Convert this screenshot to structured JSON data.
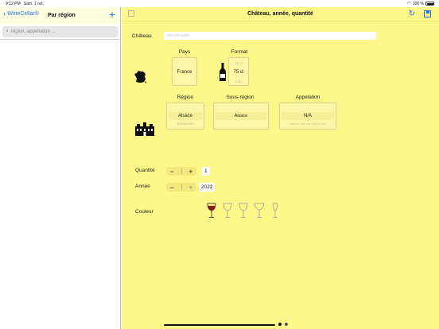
{
  "status_bar": {
    "time": "9:12 PM",
    "date": "Sam. 1 oct.",
    "battery": "100 %"
  },
  "sidebar": {
    "back_label": "WineCellar®",
    "title": "Par région",
    "add_icon": "plus-icon",
    "search": {
      "placeholder": "région, appellation ..."
    }
  },
  "main": {
    "title": "Château, année, quantité",
    "chateau": {
      "label": "Château",
      "placeholder": "non-consulté"
    },
    "pays": {
      "label": "Pays",
      "value": "France"
    },
    "format": {
      "label": "Format",
      "prev": "70 cl",
      "value": "75 cl",
      "next": "1,5 l"
    },
    "region": {
      "label": "Région",
      "value": "Alsace",
      "next": "Beaujolais"
    },
    "sous_region": {
      "label": "Sous-région",
      "value": "Alsace"
    },
    "appelation": {
      "label": "Appelation",
      "value": "N/A",
      "next": "Alsace premier grand cru"
    },
    "quantite": {
      "label": "Quantité",
      "value": "1"
    },
    "annee": {
      "label": "Année",
      "value": "2022"
    },
    "couleur": {
      "label": "Couleur"
    }
  },
  "colors": {
    "background_main": "#fef88a",
    "accent": "#1a73e8",
    "wine_red": "#8b1a1a"
  }
}
